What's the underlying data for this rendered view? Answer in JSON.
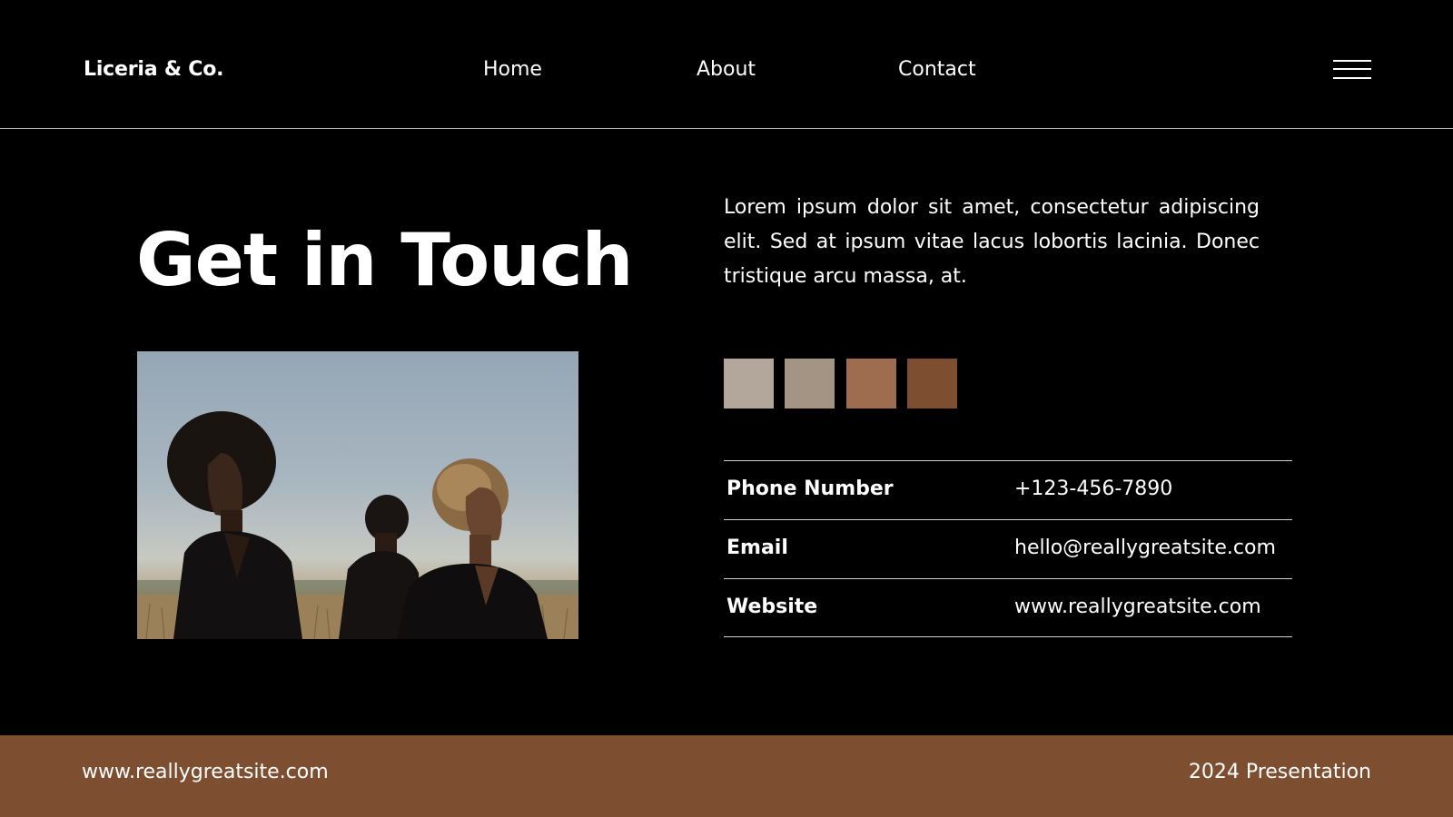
{
  "header": {
    "brand": "Liceria & Co.",
    "nav": [
      {
        "label": "Home"
      },
      {
        "label": "About"
      },
      {
        "label": "Contact"
      }
    ],
    "menu_icon": "hamburger-menu-icon"
  },
  "main": {
    "title": "Get in Touch",
    "intro": "Lorem ipsum dolor sit amet, consectetur adipiscing elit. Sed at ipsum vitae lacus lobortis lacinia. Donec tristique arcu massa, at.",
    "palette": [
      "#b3a79b",
      "#a39483",
      "#9e6d50",
      "#7d4f30"
    ],
    "contacts": [
      {
        "label": "Phone Number",
        "value": "+123-456-7890"
      },
      {
        "label": "Email",
        "value": "hello@reallygreatsite.com"
      },
      {
        "label": "Website",
        "value": "www.reallygreatsite.com"
      }
    ]
  },
  "footer": {
    "url": "www.reallygreatsite.com",
    "note": "2024 Presentation",
    "background": "#7d4f30"
  }
}
